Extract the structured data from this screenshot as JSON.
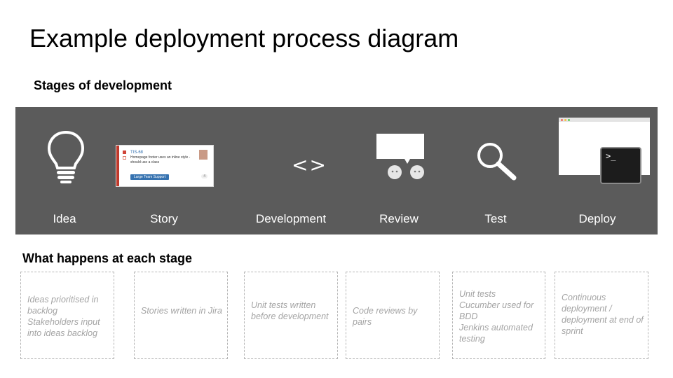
{
  "title": "Example deployment process diagram",
  "stages_heading": "Stages of development",
  "details_heading": "What happens at each stage",
  "stages": [
    {
      "label": "Idea",
      "icon": "lightbulb-icon"
    },
    {
      "label": "Story",
      "icon": "story-card-icon"
    },
    {
      "label": "Development",
      "icon": "code-brackets-icon"
    },
    {
      "label": "Review",
      "icon": "speech-bubble-faces-icon"
    },
    {
      "label": "Test",
      "icon": "magnifier-icon"
    },
    {
      "label": "Deploy",
      "icon": "terminal-window-icon"
    }
  ],
  "story_card": {
    "key": "TIS-68",
    "summary": "Homepage footer uses an inline style - should use a class",
    "badge": "Large Team Support",
    "count": "4"
  },
  "code_glyph": "<>",
  "terminal_prompt": ">_",
  "details": [
    {
      "lines": [
        "Ideas prioritised in backlog",
        "Stakeholders input into ideas backlog"
      ]
    },
    {
      "lines": [
        "Stories written in Jira"
      ]
    },
    {
      "lines": [
        "Unit tests written before development"
      ]
    },
    {
      "lines": [
        "Code reviews by pairs"
      ]
    },
    {
      "lines": [
        "Unit tests",
        "Cucumber used for BDD",
        "Jenkins automated testing"
      ]
    },
    {
      "lines": [
        "Continuous deployment / deployment at end of sprint"
      ]
    }
  ],
  "colors": {
    "band": "#5b5b5b",
    "icon": "#ffffff",
    "detail_text": "#a4a4a4",
    "detail_border": "#b5b5b5"
  }
}
